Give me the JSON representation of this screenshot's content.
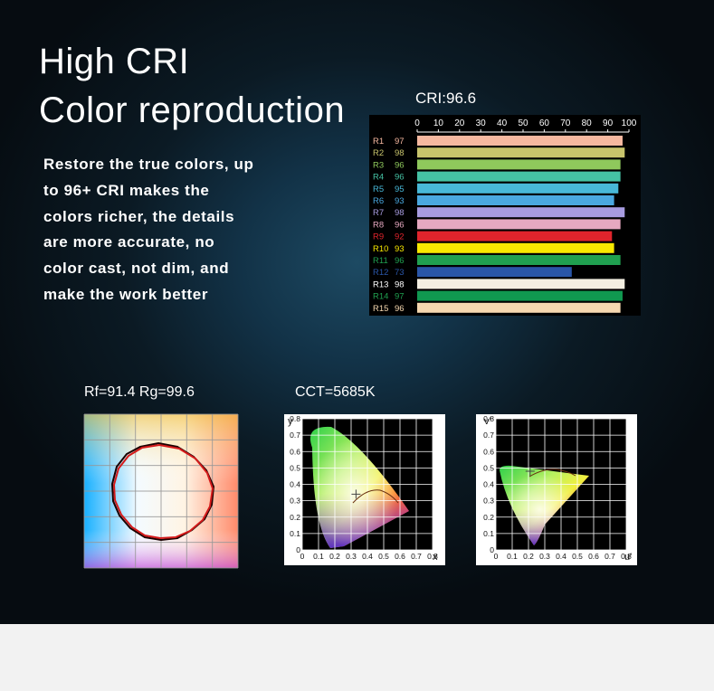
{
  "heading": {
    "line1": "High CRI",
    "line2": "Color reproduction"
  },
  "description": [
    "Restore the true colors, up",
    "to 96+ CRI makes the",
    "colors richer, the details",
    "are more accurate, no",
    "color cast, not dim, and",
    "make the work better"
  ],
  "captions": {
    "cri": "CRI:96.6",
    "rf_rg": "Rf=91.4  Rg=99.6",
    "cct": "CCT=5685K"
  },
  "chart_data": [
    {
      "type": "bar",
      "title": "CRI:96.6",
      "orientation": "horizontal",
      "xlim": [
        0,
        100
      ],
      "ticks": [
        0,
        10,
        20,
        30,
        40,
        50,
        60,
        70,
        80,
        90,
        100
      ],
      "categories": [
        "R1",
        "R2",
        "R3",
        "R4",
        "R5",
        "R6",
        "R7",
        "R8",
        "R9",
        "R10",
        "R11",
        "R12",
        "R13",
        "R14",
        "R15"
      ],
      "values": [
        97,
        98,
        96,
        96,
        95,
        93,
        98,
        96,
        92,
        93,
        96,
        73,
        98,
        97,
        96
      ],
      "colors": [
        "#f6b8a0",
        "#c8c46c",
        "#8fc85c",
        "#45c2a4",
        "#48b8d8",
        "#4aa8e0",
        "#a89ce0",
        "#e6a8c0",
        "#e0242c",
        "#f8e800",
        "#20a050",
        "#2a56a8",
        "#f4efe2",
        "#109850",
        "#f6d8b0"
      ],
      "label_colors": [
        "#f6b8a0",
        "#c8c46c",
        "#8fc85c",
        "#45c2a4",
        "#48b8d8",
        "#4aa8e0",
        "#a89ce0",
        "#e6a8c0",
        "#e0242c",
        "#f8e800",
        "#20a050",
        "#2a56a8",
        "#ffffff",
        "#20a050",
        "#f6d8b0"
      ]
    },
    {
      "type": "scatter",
      "title": "Rf=91.4  Rg=99.6",
      "grid": true
    },
    {
      "type": "scatter",
      "title": "CCT=5685K",
      "xlabel": "x",
      "ylabel": "y",
      "xlim": [
        0,
        0.8
      ],
      "ylim": [
        0,
        0.8
      ],
      "xticks": [
        "0",
        "0.1",
        "0.2",
        "0.3",
        "0.4",
        "0.5",
        "0.6",
        "0.7",
        "0.8"
      ],
      "yticks": [
        "0",
        "0.1",
        "0.2",
        "0.3",
        "0.4",
        "0.5",
        "0.6",
        "0.7",
        "0.8"
      ],
      "point": {
        "x": 0.33,
        "y": 0.34
      }
    },
    {
      "type": "scatter",
      "xlabel": "u'",
      "ylabel": "v'",
      "xlim": [
        0,
        0.8
      ],
      "ylim": [
        0,
        0.8
      ],
      "xticks": [
        "0",
        "0.1",
        "0.2",
        "0.3",
        "0.4",
        "0.5",
        "0.6",
        "0.7",
        "0.8"
      ],
      "yticks": [
        "0",
        "0.1",
        "0.2",
        "0.3",
        "0.4",
        "0.5",
        "0.6",
        "0.7",
        "0.8"
      ],
      "point": {
        "x": 0.21,
        "y": 0.48
      }
    }
  ]
}
